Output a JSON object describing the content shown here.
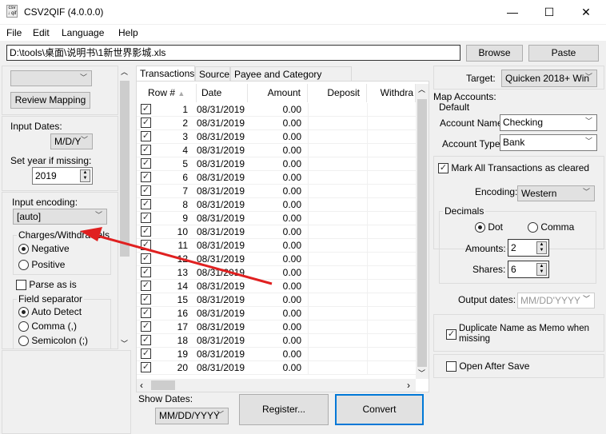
{
  "window": {
    "title": "CSV2QIF (4.0.0.0)",
    "icon_text": "csv ↓ qif",
    "minimize": "—",
    "maximize": "☐",
    "close": "✕"
  },
  "menu": [
    "File",
    "Edit",
    "Language",
    "Help"
  ],
  "path": {
    "value": "D:\\tools\\桌面\\说明书\\1新世界影城.xls",
    "browse": "Browse",
    "paste": "Paste"
  },
  "left": {
    "top_select": "",
    "review_mapping": "Review Mapping",
    "input_dates_label": "Input Dates:",
    "input_dates": "M/D/Y",
    "set_year_label": "Set year if missing:",
    "year": "2019",
    "input_encoding_label": "Input encoding:",
    "input_encoding": "[auto]",
    "charges_label": "Charges/Withdrawals",
    "negative": "Negative",
    "positive": "Positive",
    "charges_selected": "Negative",
    "parse_as_is": "Parse as is",
    "parse_checked": false,
    "field_sep_label": "Field separator",
    "auto_detect": "Auto Detect",
    "comma": "Comma (,)",
    "semicolon": "Semicolon (;)",
    "sep_selected": "Auto Detect"
  },
  "tabs": [
    "Transactions",
    "Source",
    "Payee and Category Mapping"
  ],
  "table": {
    "columns": [
      "Row #",
      "Date",
      "Amount",
      "Deposit",
      "Withdra"
    ],
    "rows": [
      {
        "n": "1",
        "date": "08/31/2019",
        "amount": "0.00"
      },
      {
        "n": "2",
        "date": "08/31/2019",
        "amount": "0.00"
      },
      {
        "n": "3",
        "date": "08/31/2019",
        "amount": "0.00"
      },
      {
        "n": "4",
        "date": "08/31/2019",
        "amount": "0.00"
      },
      {
        "n": "5",
        "date": "08/31/2019",
        "amount": "0.00"
      },
      {
        "n": "6",
        "date": "08/31/2019",
        "amount": "0.00"
      },
      {
        "n": "7",
        "date": "08/31/2019",
        "amount": "0.00"
      },
      {
        "n": "8",
        "date": "08/31/2019",
        "amount": "0.00"
      },
      {
        "n": "9",
        "date": "08/31/2019",
        "amount": "0.00"
      },
      {
        "n": "10",
        "date": "08/31/2019",
        "amount": "0.00"
      },
      {
        "n": "11",
        "date": "08/31/2019",
        "amount": "0.00"
      },
      {
        "n": "12",
        "date": "08/31/2019",
        "amount": "0.00"
      },
      {
        "n": "13",
        "date": "08/31/2019",
        "amount": "0.00"
      },
      {
        "n": "14",
        "date": "08/31/2019",
        "amount": "0.00"
      },
      {
        "n": "15",
        "date": "08/31/2019",
        "amount": "0.00"
      },
      {
        "n": "16",
        "date": "08/31/2019",
        "amount": "0.00"
      },
      {
        "n": "17",
        "date": "08/31/2019",
        "amount": "0.00"
      },
      {
        "n": "18",
        "date": "08/31/2019",
        "amount": "0.00"
      },
      {
        "n": "19",
        "date": "08/31/2019",
        "amount": "0.00"
      },
      {
        "n": "20",
        "date": "08/31/2019",
        "amount": "0.00"
      }
    ]
  },
  "bottom": {
    "show_dates_label": "Show Dates:",
    "show_dates": "MM/DD/YYYY",
    "register": "Register...",
    "convert": "Convert"
  },
  "right": {
    "target_label": "Target:",
    "target": "Quicken 2018+ Win",
    "map_accounts": "Map Accounts:",
    "default": "Default",
    "account_name_label": "Account Name:",
    "account_name": "Checking",
    "account_type_label": "Account Type:",
    "account_type": "Bank",
    "mark_cleared": "Mark All Transactions as cleared",
    "mark_cleared_checked": true,
    "encoding_label": "Encoding:",
    "encoding": "Western",
    "decimals": "Decimals",
    "dot": "Dot",
    "comma": "Comma",
    "decimal_selected": "Dot",
    "amounts_label": "Amounts:",
    "amounts": "2",
    "shares_label": "Shares:",
    "shares": "6",
    "output_dates_label": "Output dates:",
    "output_dates": "MM/DD'YYYY",
    "dup_name": "Duplicate Name as Memo when missing",
    "dup_checked": true,
    "open_after_save": "Open After Save",
    "open_checked": false
  },
  "colors": {
    "accent": "#0078d7",
    "annotation_arrow": "#e02020"
  }
}
